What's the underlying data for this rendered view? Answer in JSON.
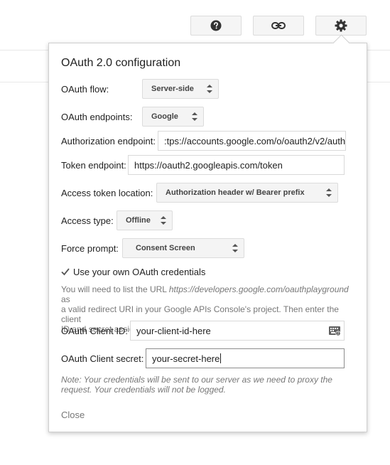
{
  "toolbar": {
    "help_icon": "question-circle-icon",
    "link_icon": "link-icon",
    "settings_icon": "gear-icon"
  },
  "panel": {
    "title": "OAuth 2.0 configuration",
    "oauth_flow": {
      "label": "OAuth flow:",
      "value": "Server-side"
    },
    "oauth_endpoints": {
      "label": "OAuth endpoints:",
      "value": "Google"
    },
    "authorization_endpoint": {
      "label": "Authorization endpoint:",
      "value": ":tps://accounts.google.com/o/oauth2/v2/auth"
    },
    "token_endpoint": {
      "label": "Token endpoint:",
      "value": "https://oauth2.googleapis.com/token"
    },
    "access_token_location": {
      "label": "Access token location:",
      "value": "Authorization header w/ Bearer prefix"
    },
    "access_type": {
      "label": "Access type:",
      "value": "Offline"
    },
    "force_prompt": {
      "label": "Force prompt:",
      "value": "Consent Screen"
    },
    "own_credentials": {
      "label": "Use your own OAuth credentials",
      "checked": true
    },
    "help_text": {
      "line1_pre": "You will need to list the URL ",
      "line1_url": "https://developers.google.com/oauthplayground",
      "line1_post": " as",
      "line2": "a valid redirect URI in your Google APIs Console's project. Then enter the client",
      "line3": "ID and secret assigned to a web application on your project below:"
    },
    "client_id": {
      "label": "OAuth Client ID:",
      "value": "your-client-id-here"
    },
    "client_secret": {
      "label": "OAuth Client secret:",
      "value": "your-secret-here"
    },
    "note": {
      "line1": "Note: Your credentials will be sent to our server as we need to proxy the",
      "line2": "request. Your credentials will not be logged."
    },
    "close_label": "Close"
  },
  "colors": {
    "panel_border": "#cfcfcf",
    "button_bg": "#f4f4f4",
    "muted_text": "#777777"
  }
}
